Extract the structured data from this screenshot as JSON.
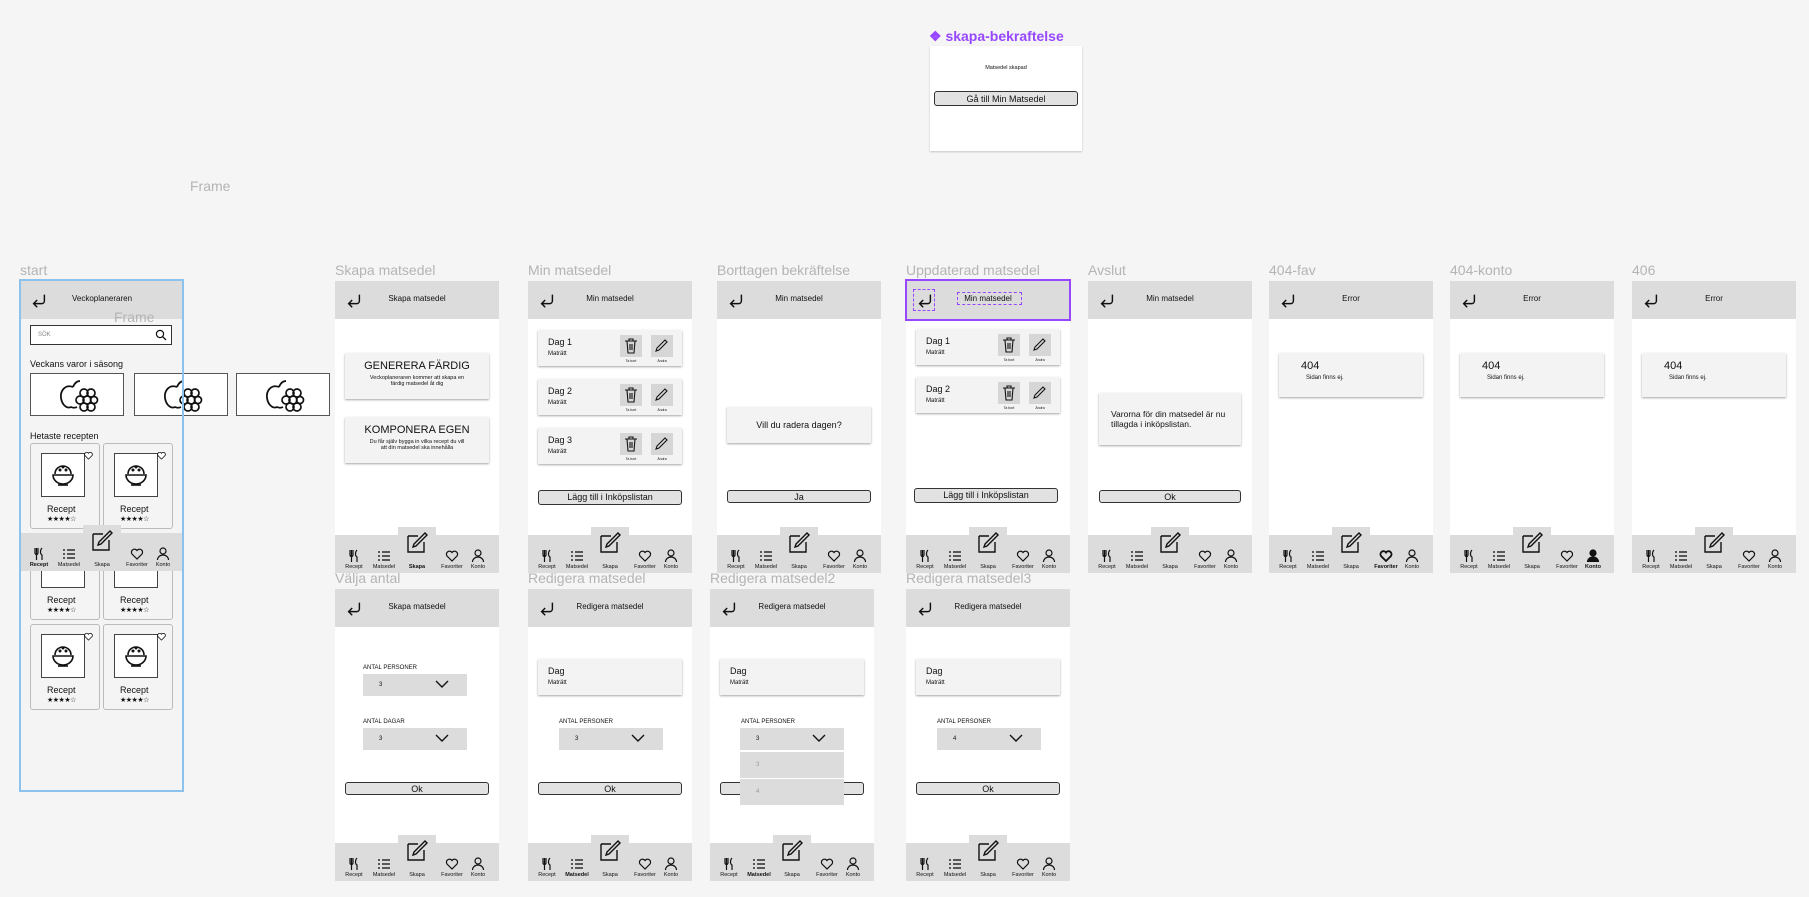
{
  "canvas_labels": {
    "frame_top": "Frame",
    "frame_inner": "Frame",
    "component_title": "❖ skapa-bekraftelse"
  },
  "skapa_bekraftelse": {
    "text": "Matsedel skapad",
    "button": "Gå till Min Matsedel"
  },
  "nav": {
    "recept": "Recept",
    "matsedel": "Matsedel",
    "skapa": "Skapa",
    "favoriter": "Favoriter",
    "konto": "Konto"
  },
  "start": {
    "label": "start",
    "header": "Veckoplaneraren",
    "search_placeholder": "SÖK",
    "season_title": "Veckans varor i säsong",
    "hot_title": "Hetaste recepten",
    "recipe_label": "Recept",
    "stars": "★★★★☆"
  },
  "skapa_matsedel": {
    "label": "Skapa matsedel",
    "header": "Skapa matsedel",
    "opt1_title": "GENERERA FÄRDIG",
    "opt1_desc": "Veckoplaneraren kommer att skapa en färdig matsedel åt dig",
    "opt2_title": "KOMPONERA EGEN",
    "opt2_desc": "Du får själv bygga in vilka recept du vill att din matsedel ska innehålla"
  },
  "min_matsedel": {
    "label": "Min matsedel",
    "header": "Min matsedel",
    "days": [
      "Dag 1",
      "Dag 2",
      "Dag 3"
    ],
    "dish": "Maträtt",
    "remove": "Ta bort",
    "edit": "Ändra",
    "add_button": "Lägg till i Inköpslistan"
  },
  "borttagen": {
    "label": "Borttagen bekräftelse",
    "header": "Min matsedel",
    "question": "Vill du radera dagen?",
    "yes": "Ja"
  },
  "uppdaterad": {
    "label": "Uppdaterad matsedel",
    "header": "Min matsedel",
    "days": [
      "Dag 1",
      "Dag 2"
    ],
    "add_button": "Lägg till i Inköpslistan"
  },
  "avslut": {
    "label": "Avslut",
    "header": "Min matsedel",
    "message": "Varorna för din matsedel är nu tillagda i inköpslistan.",
    "ok": "Ok"
  },
  "errors": [
    {
      "label": "404-fav",
      "header": "Error",
      "code": "404",
      "msg": "Sidan finns ej."
    },
    {
      "label": "404-konto",
      "header": "Error",
      "code": "404",
      "msg": "Sidan finns ej."
    },
    {
      "label": "406",
      "header": "Error",
      "code": "404",
      "msg": "Sidan finns ej."
    }
  ],
  "valja_antal": {
    "label": "Välja antal",
    "header": "Skapa matsedel",
    "persons_label": "ANTAL PERSONER",
    "persons_value": "3",
    "days_label": "ANTAL DAGAR",
    "days_value": "3",
    "ok": "Ok"
  },
  "redigera": {
    "label": "Redigera matsedel",
    "header": "Redigera matsedel",
    "day": "Dag",
    "dish": "Maträtt",
    "persons_label": "ANTAL PERSONER",
    "persons_value": "3",
    "ok": "Ok"
  },
  "redigera2": {
    "label": "Redigera matsedel2",
    "header": "Redigera matsedel",
    "day": "Dag",
    "dish": "Maträtt",
    "persons_label": "ANTAL PERSONER",
    "persons_value": "3",
    "options": [
      "3",
      "4"
    ]
  },
  "redigera3": {
    "label": "Redigera matsedel3",
    "header": "Redigera matsedel",
    "day": "Dag",
    "dish": "Maträtt",
    "persons_label": "ANTAL PERSONER",
    "persons_value": "4",
    "ok": "Ok"
  },
  "colors": {
    "canvas": "#f5f5f5",
    "selection_blue": "#8cc2ee",
    "component_purple": "#9747ff",
    "header_gray": "#dcdcdc"
  },
  "icons": [
    "back-arrow-icon",
    "search-icon",
    "fork-knife-icon",
    "list-icon",
    "pencil-icon",
    "heart-icon",
    "person-icon",
    "trash-icon",
    "chevron-down-icon",
    "fruit-icon",
    "food-bowl-icon"
  ]
}
